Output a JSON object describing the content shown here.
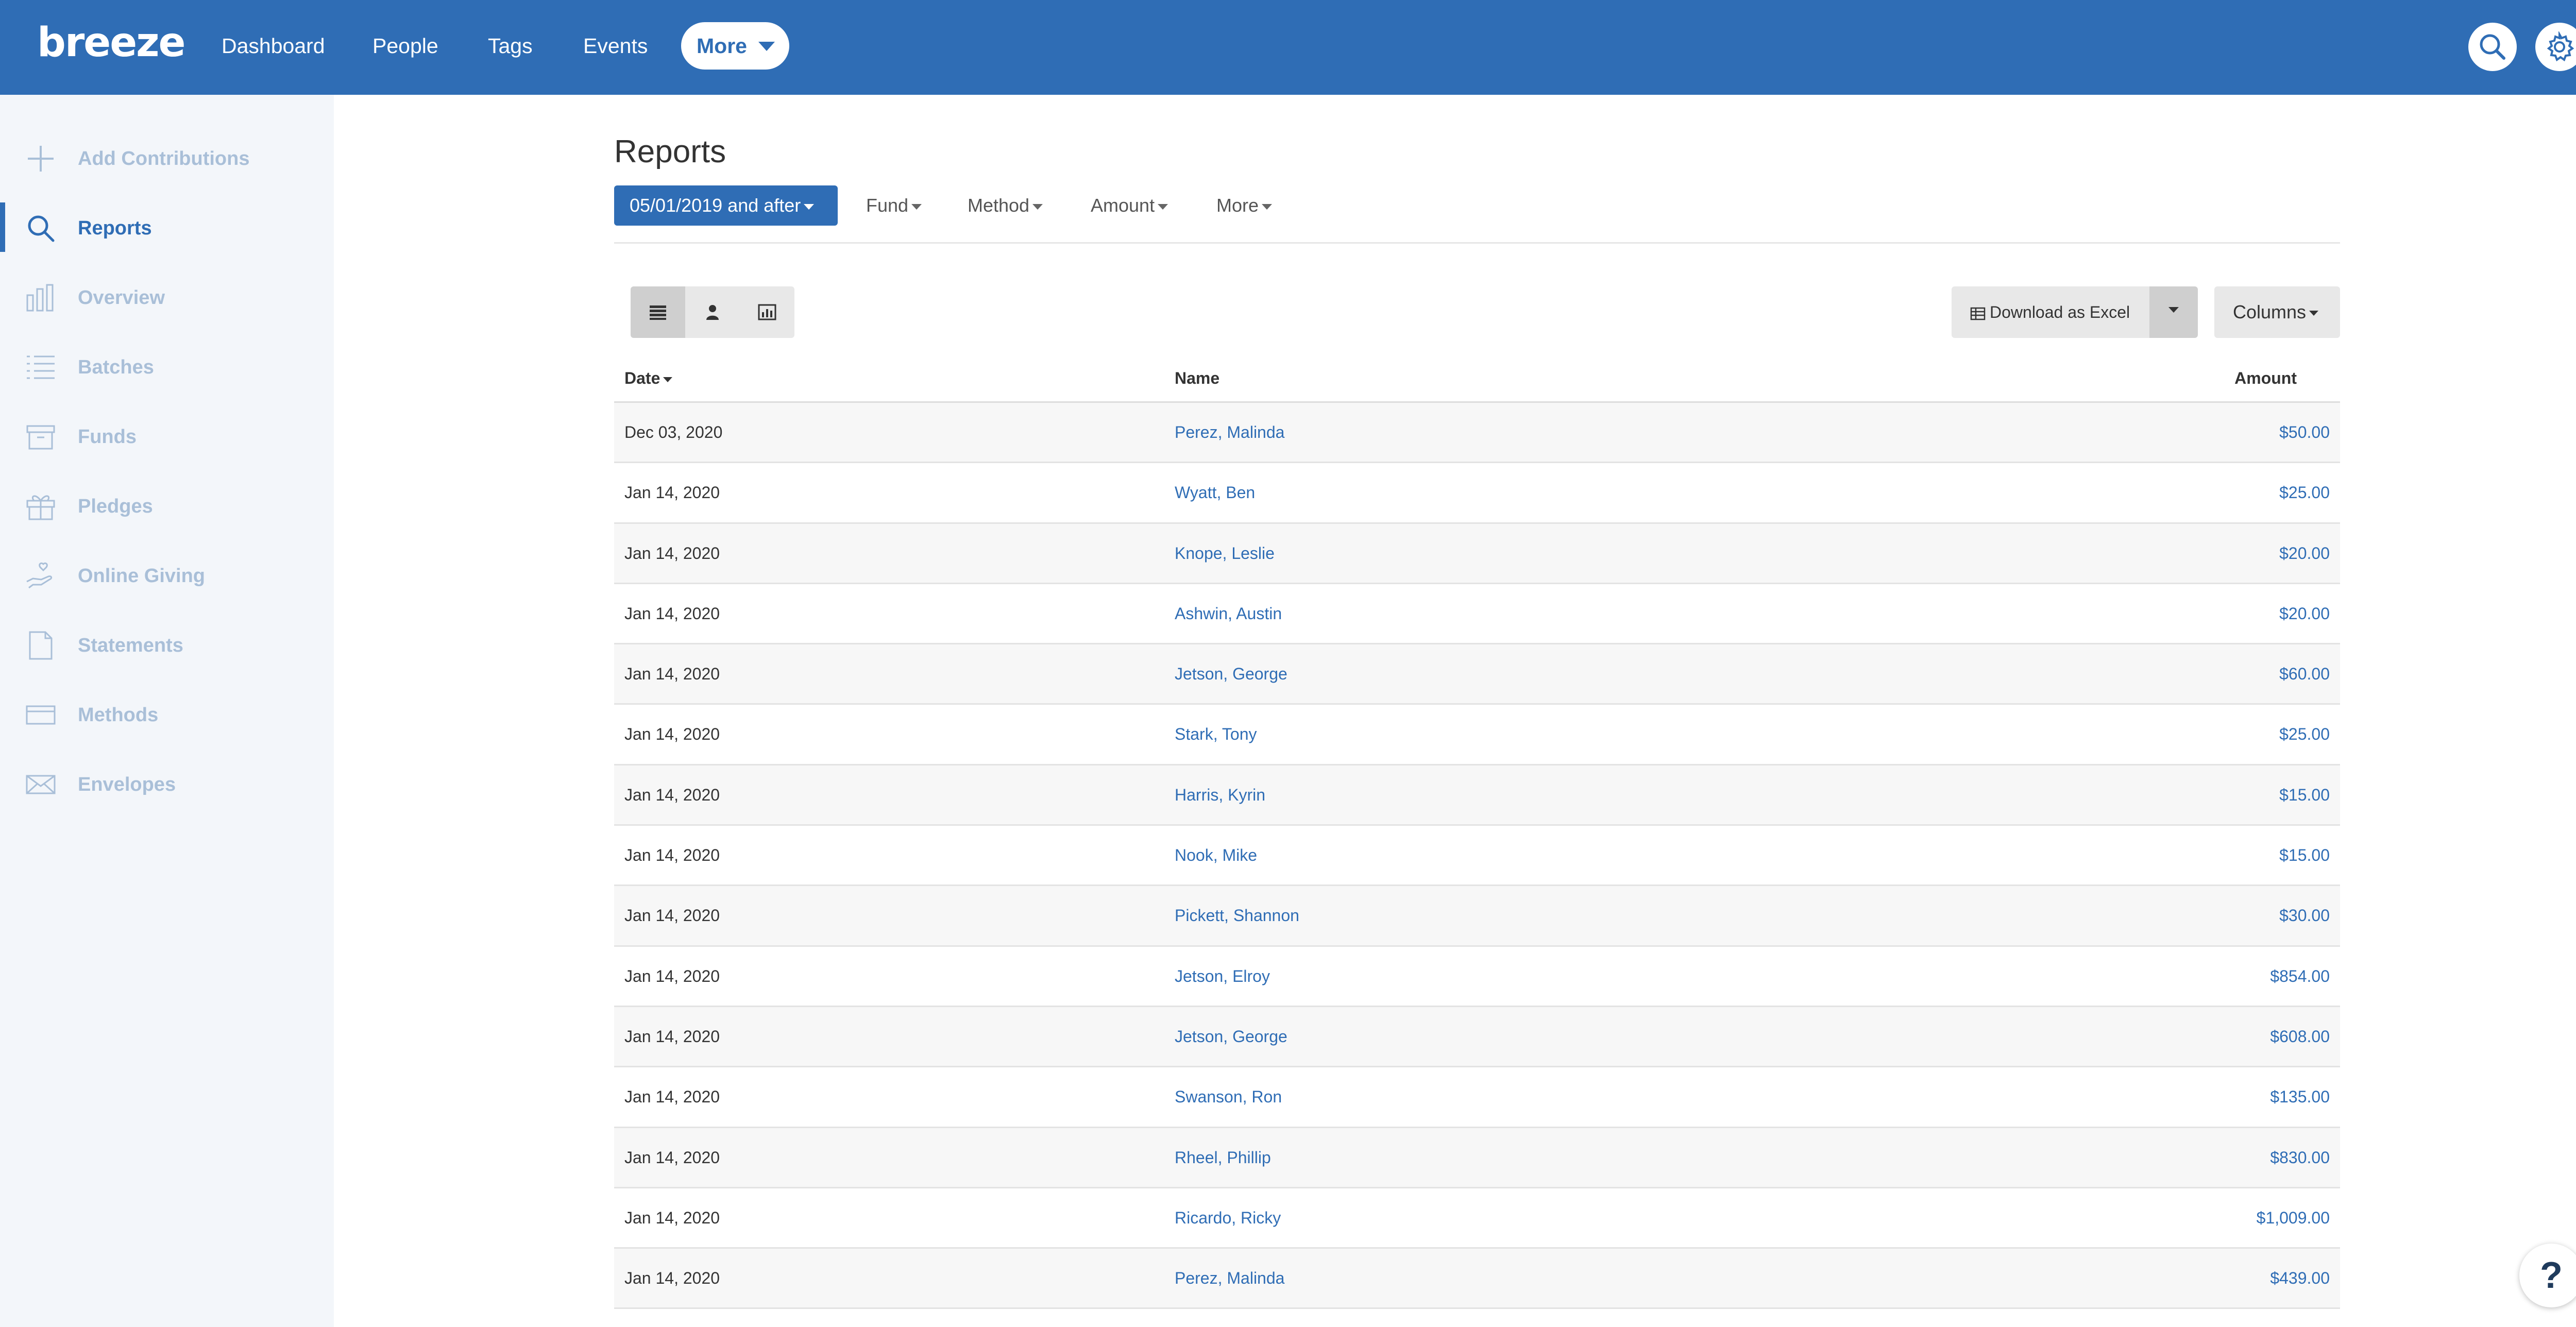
{
  "topnav": {
    "logo": "breeze",
    "links": [
      "Dashboard",
      "People",
      "Tags",
      "Events"
    ],
    "more_label": "More",
    "colors": {
      "background": "#2f6db5",
      "text": "#ffffff"
    }
  },
  "sidebar": {
    "items": [
      {
        "label": "Add Contributions",
        "icon": "plus-icon",
        "active": false
      },
      {
        "label": "Reports",
        "icon": "search-icon",
        "active": true
      },
      {
        "label": "Overview",
        "icon": "bar-chart-icon",
        "active": false
      },
      {
        "label": "Batches",
        "icon": "list-icon",
        "active": false
      },
      {
        "label": "Funds",
        "icon": "box-icon",
        "active": false
      },
      {
        "label": "Pledges",
        "icon": "gift-icon",
        "active": false
      },
      {
        "label": "Online Giving",
        "icon": "hand-heart-icon",
        "active": false
      },
      {
        "label": "Statements",
        "icon": "document-icon",
        "active": false
      },
      {
        "label": "Methods",
        "icon": "credit-card-icon",
        "active": false
      },
      {
        "label": "Envelopes",
        "icon": "envelope-icon",
        "active": false
      }
    ]
  },
  "main": {
    "title": "Reports",
    "filters": {
      "date": "05/01/2019 and after",
      "fund": "Fund",
      "method": "Method",
      "amount": "Amount",
      "more": "More"
    },
    "view_buttons": [
      "list-view-icon",
      "person-view-icon",
      "chart-view-icon"
    ],
    "download_label": "Download as Excel",
    "columns_label": "Columns",
    "table": {
      "headers": {
        "date": "Date",
        "name": "Name",
        "amount": "Amount"
      },
      "rows": [
        {
          "date": "Dec 03, 2020",
          "name": "Perez, Malinda",
          "amount": "$50.00"
        },
        {
          "date": "Jan 14, 2020",
          "name": "Wyatt, Ben",
          "amount": "$25.00"
        },
        {
          "date": "Jan 14, 2020",
          "name": "Knope, Leslie",
          "amount": "$20.00"
        },
        {
          "date": "Jan 14, 2020",
          "name": "Ashwin, Austin",
          "amount": "$20.00"
        },
        {
          "date": "Jan 14, 2020",
          "name": "Jetson, George",
          "amount": "$60.00"
        },
        {
          "date": "Jan 14, 2020",
          "name": "Stark, Tony",
          "amount": "$25.00"
        },
        {
          "date": "Jan 14, 2020",
          "name": "Harris, Kyrin",
          "amount": "$15.00"
        },
        {
          "date": "Jan 14, 2020",
          "name": "Nook, Mike",
          "amount": "$15.00"
        },
        {
          "date": "Jan 14, 2020",
          "name": "Pickett, Shannon",
          "amount": "$30.00"
        },
        {
          "date": "Jan 14, 2020",
          "name": "Jetson, Elroy",
          "amount": "$854.00"
        },
        {
          "date": "Jan 14, 2020",
          "name": "Jetson, George",
          "amount": "$608.00"
        },
        {
          "date": "Jan 14, 2020",
          "name": "Swanson, Ron",
          "amount": "$135.00"
        },
        {
          "date": "Jan 14, 2020",
          "name": "Rheel, Phillip",
          "amount": "$830.00"
        },
        {
          "date": "Jan 14, 2020",
          "name": "Ricardo, Ricky",
          "amount": "$1,009.00"
        },
        {
          "date": "Jan 14, 2020",
          "name": "Perez, Malinda",
          "amount": "$439.00"
        }
      ]
    }
  },
  "help_label": "?"
}
